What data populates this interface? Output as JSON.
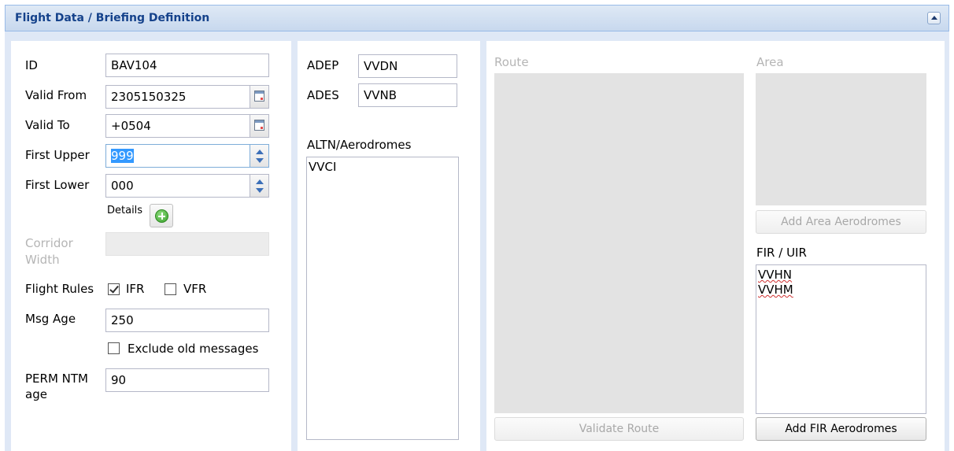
{
  "panel": {
    "title": "Flight Data / Briefing Definition"
  },
  "left": {
    "id_label": "ID",
    "id_value": "BAV104",
    "valid_from_label": "Valid From",
    "valid_from_value": "2305150325",
    "valid_to_label": "Valid To",
    "valid_to_value": "+0504",
    "first_upper_label": "First Upper",
    "first_upper_value": "999",
    "first_lower_label": "First Lower",
    "first_lower_value": "000",
    "details_label": "Details",
    "corridor_label_1": "Corridor",
    "corridor_label_2": "Width",
    "corridor_value": "",
    "flight_rules_label": "Flight Rules",
    "ifr_label": "IFR",
    "ifr_checked": true,
    "vfr_label": "VFR",
    "vfr_checked": false,
    "msg_age_label": "Msg Age",
    "msg_age_value": "250",
    "exclude_old_label": "Exclude old messages",
    "exclude_old_checked": false,
    "perm_ntm_label_1": "PERM NTM",
    "perm_ntm_label_2": "age",
    "perm_ntm_value": "90"
  },
  "middle": {
    "adep_label": "ADEP",
    "adep_value": "VVDN",
    "ades_label": "ADES",
    "ades_value": "VVNB",
    "altn_label": "ALTN/Aerodromes",
    "altn_items": [
      "VVCI"
    ]
  },
  "right": {
    "route_label": "Route",
    "validate_route_label": "Validate Route",
    "area_label": "Area",
    "add_area_label": "Add Area Aerodromes",
    "fir_label": "FIR / UIR",
    "fir_items": [
      "VVHN",
      "VVHM"
    ],
    "add_fir_label": "Add FIR Aerodromes"
  }
}
